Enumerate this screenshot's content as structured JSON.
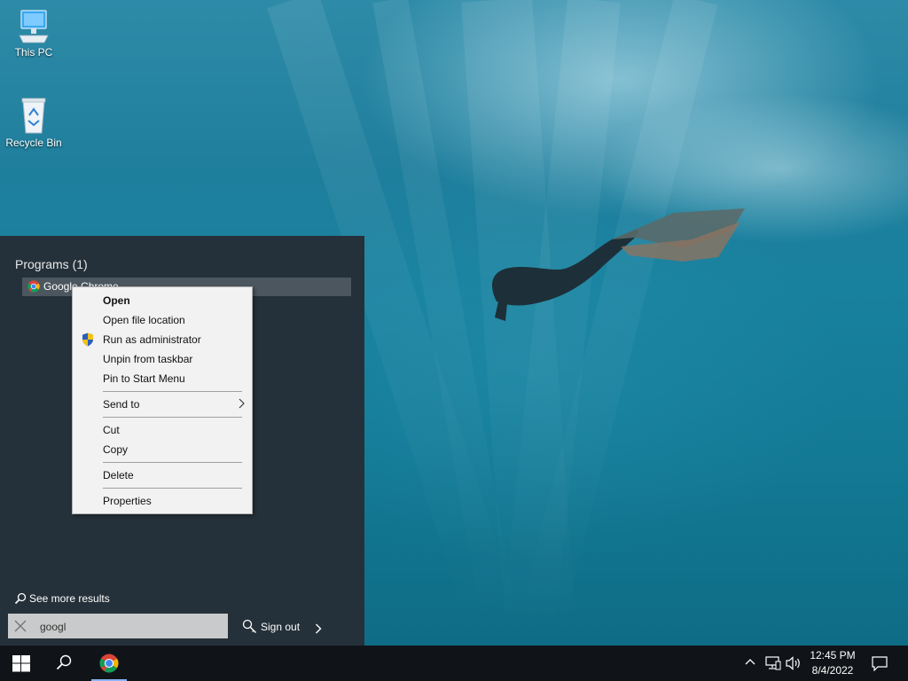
{
  "desktop": {
    "icons": [
      {
        "label": "This PC"
      },
      {
        "label": "Recycle Bin"
      }
    ]
  },
  "start_panel": {
    "programs_header": "Programs (1)",
    "programs": [
      {
        "label": "Google Chrome"
      }
    ],
    "see_more": "See more results",
    "search": {
      "value": "googl"
    },
    "sign_out": "Sign out"
  },
  "context_menu": {
    "items": [
      {
        "label": "Open",
        "bold": true
      },
      {
        "label": "Open file location"
      },
      {
        "label": "Run as administrator",
        "icon": "uac-shield-icon"
      },
      {
        "label": "Unpin from taskbar"
      },
      {
        "label": "Pin to Start Menu"
      },
      {
        "label": "Send to",
        "submenu": true
      },
      {
        "label": "Cut"
      },
      {
        "label": "Copy"
      },
      {
        "label": "Delete"
      },
      {
        "label": "Properties"
      }
    ]
  },
  "taskbar": {
    "icons": [
      "windows-logo-icon",
      "search-icon",
      "chrome-icon"
    ],
    "tray_icons": [
      "chevron-up-icon",
      "network-icon",
      "volume-icon",
      "notification-icon"
    ],
    "clock": {
      "time": "12:45 PM",
      "date": "8/4/2022"
    }
  },
  "colors": {
    "start_panel_bg": "#25313a",
    "taskbar_bg": "#101418",
    "menu_bg": "#f2f2f2",
    "selected_row_bg": "#4b565e",
    "search_box_bg": "#c9cacb"
  }
}
